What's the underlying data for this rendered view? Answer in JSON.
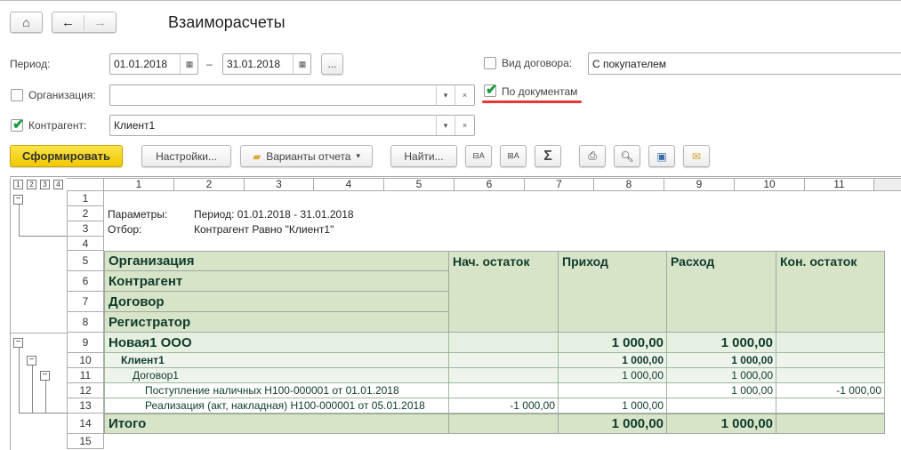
{
  "header": {
    "title": "Взаиморасчеты"
  },
  "filters": {
    "period_label": "Период:",
    "date_from": "01.01.2018",
    "dash": "–",
    "date_to": "31.01.2018",
    "more": "...",
    "org_label": "Организация:",
    "org_checked": false,
    "org_value": "",
    "contractor_label": "Контрагент:",
    "contractor_checked": true,
    "contractor_value": "Клиент1",
    "contract_type_label": "Вид договора:",
    "contract_type_checked": false,
    "contract_type_value": "С покупателем",
    "by_docs_label": "По документам",
    "by_docs_checked": true,
    "clear": "×"
  },
  "toolbar": {
    "generate": "Сформировать",
    "settings": "Настройки...",
    "variants": "Варианты отчета",
    "find": "Найти...",
    "sigma": "Σ"
  },
  "sheet": {
    "levels": [
      "1",
      "2",
      "3",
      "4"
    ],
    "columns": [
      "1",
      "2",
      "3",
      "4",
      "5",
      "6",
      "7",
      "8",
      "9",
      "10",
      "11"
    ],
    "rows": [
      "1",
      "2",
      "3",
      "4",
      "5",
      "6",
      "7",
      "8",
      "9",
      "10",
      "11",
      "12",
      "13",
      "14",
      "15"
    ],
    "params_label": "Параметры:",
    "params_value": "Период: 01.01.2018 - 31.01.2018",
    "filter_label": "Отбор:",
    "filter_value": "Контрагент Равно \"Клиент1\"",
    "group_headers": [
      "Организация",
      "Контрагент",
      "Договор",
      "Регистратор"
    ],
    "value_headers": [
      "Нач. остаток",
      "Приход",
      "Расход",
      "Кон. остаток"
    ],
    "data": [
      {
        "name": "Новая1 ООО",
        "values": [
          "",
          "1 000,00",
          "1 000,00",
          ""
        ]
      },
      {
        "name": "Клиент1",
        "values": [
          "",
          "1 000,00",
          "1 000,00",
          ""
        ]
      },
      {
        "name": "Договор1",
        "values": [
          "",
          "1 000,00",
          "1 000,00",
          ""
        ]
      },
      {
        "name": "Поступление наличных Н100-000001 от 01.01.2018",
        "values": [
          "",
          "",
          "1 000,00",
          "-1 000,00"
        ]
      },
      {
        "name": "Реализация (акт, накладная) Н100-000001 от 05.01.2018",
        "values": [
          "-1 000,00",
          "1 000,00",
          "",
          ""
        ]
      },
      {
        "name": "Итого",
        "values": [
          "",
          "1 000,00",
          "1 000,00",
          ""
        ]
      }
    ]
  }
}
